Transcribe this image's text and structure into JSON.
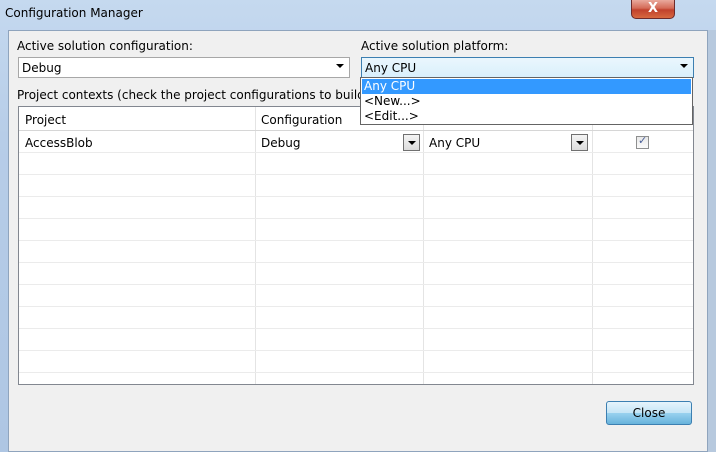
{
  "window": {
    "title": "Configuration Manager",
    "close_symbol": "X"
  },
  "config_label": "Active solution configuration:",
  "config_value": "Debug",
  "platform_label": "Active solution platform:",
  "platform_value": "Any CPU",
  "platform_options": [
    "Any CPU",
    "<New...>",
    "<Edit...>"
  ],
  "contexts_label": "Project contexts (check the project configurations to build or dep",
  "table": {
    "headers": [
      "Project",
      "Configuration"
    ],
    "rows": [
      {
        "project": "AccessBlob",
        "configuration": "Debug",
        "platform": "Any CPU",
        "build": true
      }
    ]
  },
  "close_button_label": "Close",
  "colors": {
    "selection": "#3399ff",
    "accent_border": "#3c7fb1"
  }
}
